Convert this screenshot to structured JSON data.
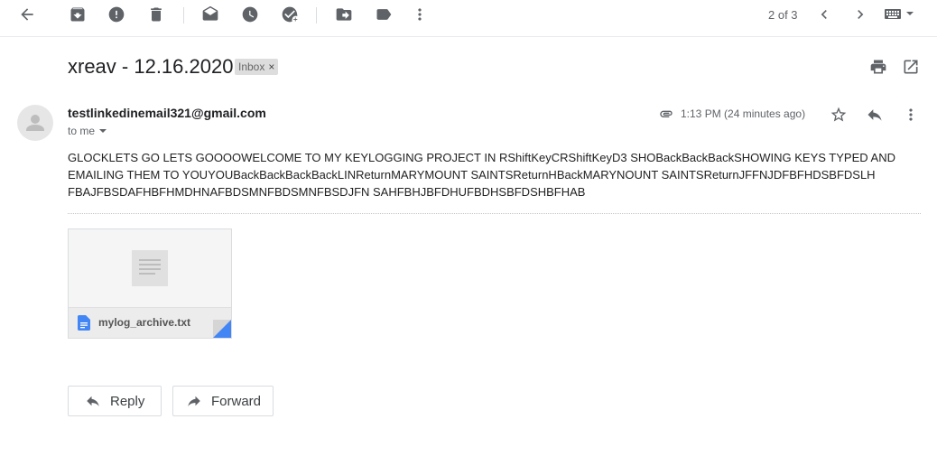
{
  "toolbar": {
    "icons": [
      "back-arrow-icon",
      "archive-icon",
      "report-spam-icon",
      "delete-icon",
      "mark-unread-icon",
      "snooze-icon",
      "add-to-tasks-icon",
      "move-to-icon",
      "labels-icon",
      "more-vert-icon"
    ],
    "pager": "2 of 3"
  },
  "email": {
    "subject": "xreav - 12.16.2020",
    "label": "Inbox",
    "label_close": "×",
    "sender": "testlinkedinemail321@gmail.com",
    "to": "to me",
    "time": "1:13 PM (24 minutes ago)",
    "body": "GLOCKLETS GO LETS GOOOOWELCOME TO MY KEYLOGGING PROJECT IN RShiftKeyCRShiftKeyD3 SHOBackBackBackSHOWING KEYS TYPED AND EMAILING THEM TO YOUYOUBackBackBackBackLINReturnMARYMOUNT SAINTSReturnHBackMARYNOUNT SAINTSReturnJFFNJDFBFHDSBFDSLH FBAJFBSDAFHBFHMDHNAFBDSMNFBDSMNFBSDJFN SAHFBHJBFDHUFBDHSBFDSHBFHAB"
  },
  "attachment": {
    "filename": "mylog_archive.txt"
  },
  "actions": {
    "reply": "Reply",
    "forward": "Forward"
  },
  "colors": {
    "icon": "#5f6368",
    "file_blue": "#4285f4"
  }
}
